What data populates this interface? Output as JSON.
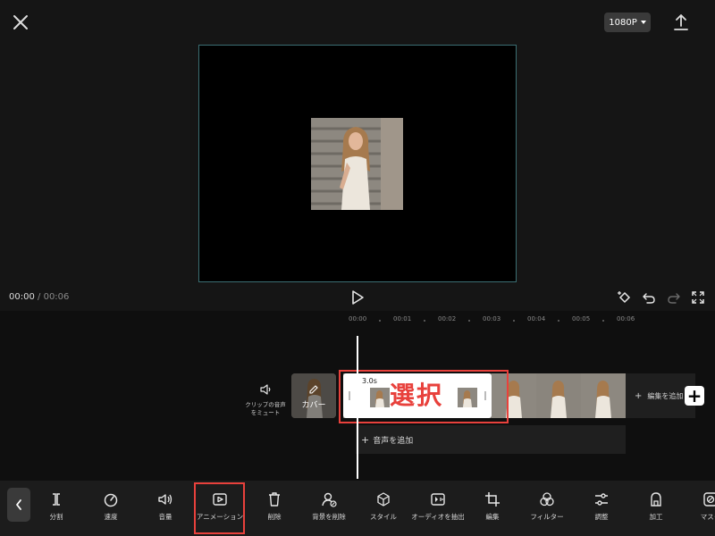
{
  "header": {
    "resolution": "1080P"
  },
  "preview": {
    "current_time": "00:00",
    "separator": "/",
    "total_time": "00:06"
  },
  "timeline": {
    "ticks": [
      "00:00",
      "00:01",
      "00:02",
      "00:03",
      "00:04",
      "00:05",
      "00:06"
    ],
    "mute_label": "クリップの音声をミュート",
    "cover_label": "カバー",
    "clip_duration": "3.0s",
    "selection_annotation": "選択",
    "add_edit_label": "編集を追加",
    "add_audio_label": "音声を追加"
  },
  "toolbar": {
    "items": [
      {
        "label": "分割",
        "icon": "split-icon"
      },
      {
        "label": "速度",
        "icon": "speed-icon"
      },
      {
        "label": "音量",
        "icon": "volume-icon"
      },
      {
        "label": "アニメーション",
        "icon": "animation-icon"
      },
      {
        "label": "削除",
        "icon": "trash-icon"
      },
      {
        "label": "背景を削除",
        "icon": "remove-background-icon"
      },
      {
        "label": "スタイル",
        "icon": "style-icon"
      },
      {
        "label": "オーディオを抽出",
        "icon": "extract-audio-icon"
      },
      {
        "label": "編集",
        "icon": "crop-icon"
      },
      {
        "label": "フィルター",
        "icon": "filter-icon"
      },
      {
        "label": "調整",
        "icon": "adjust-icon"
      },
      {
        "label": "加工",
        "icon": "retouch-icon"
      },
      {
        "label": "マスク",
        "icon": "mask-icon"
      }
    ]
  },
  "colors": {
    "accent_annotation": "#e8413c",
    "canvas_border": "#3b6e73"
  }
}
